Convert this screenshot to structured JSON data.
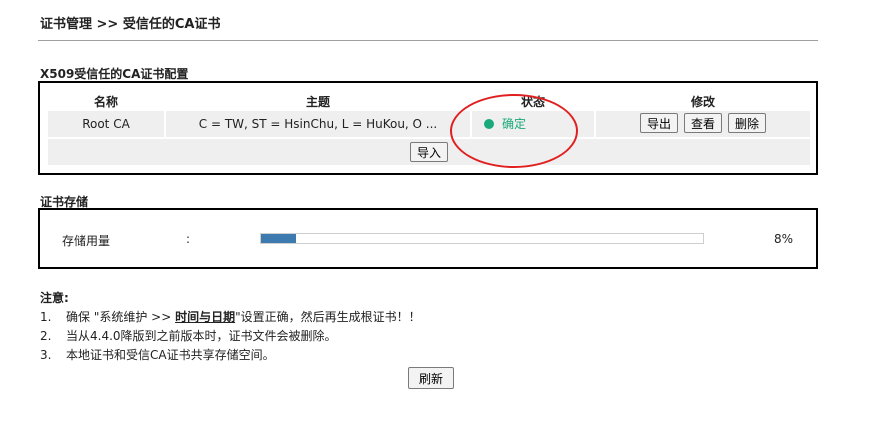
{
  "breadcrumb": "证书管理 >> 受信任的CA证书",
  "cert_section": {
    "title": "X509受信任的CA证书配置",
    "headers": {
      "name": "名称",
      "subject": "主题",
      "status": "状态",
      "modify": "修改"
    },
    "row": {
      "name": "Root CA",
      "subject": "C = TW, ST = HsinChu, L = HuKou, O ...",
      "status": "确定",
      "status_color": "#1aa97a",
      "buttons": {
        "export": "导出",
        "view": "查看",
        "delete": "删除"
      }
    },
    "import_button": "导入"
  },
  "storage_section": {
    "title": "证书存储",
    "label": "存储用量",
    "colon": ":",
    "usage_percent": 8,
    "usage_text": "8%",
    "bar_color": "#3c7ab0"
  },
  "notes": {
    "title": "注意:",
    "items": [
      {
        "num": "1.",
        "pre": "确保 \"系统维护 >> ",
        "link": "时间与日期",
        "post": "\"设置正确，然后再生成根证书！！"
      },
      {
        "num": "2.",
        "text": "当从4.4.0降版到之前版本时，证书文件会被删除。"
      },
      {
        "num": "3.",
        "text": "本地证书和受信CA证书共享存储空间。"
      }
    ]
  },
  "refresh_button": "刷新"
}
